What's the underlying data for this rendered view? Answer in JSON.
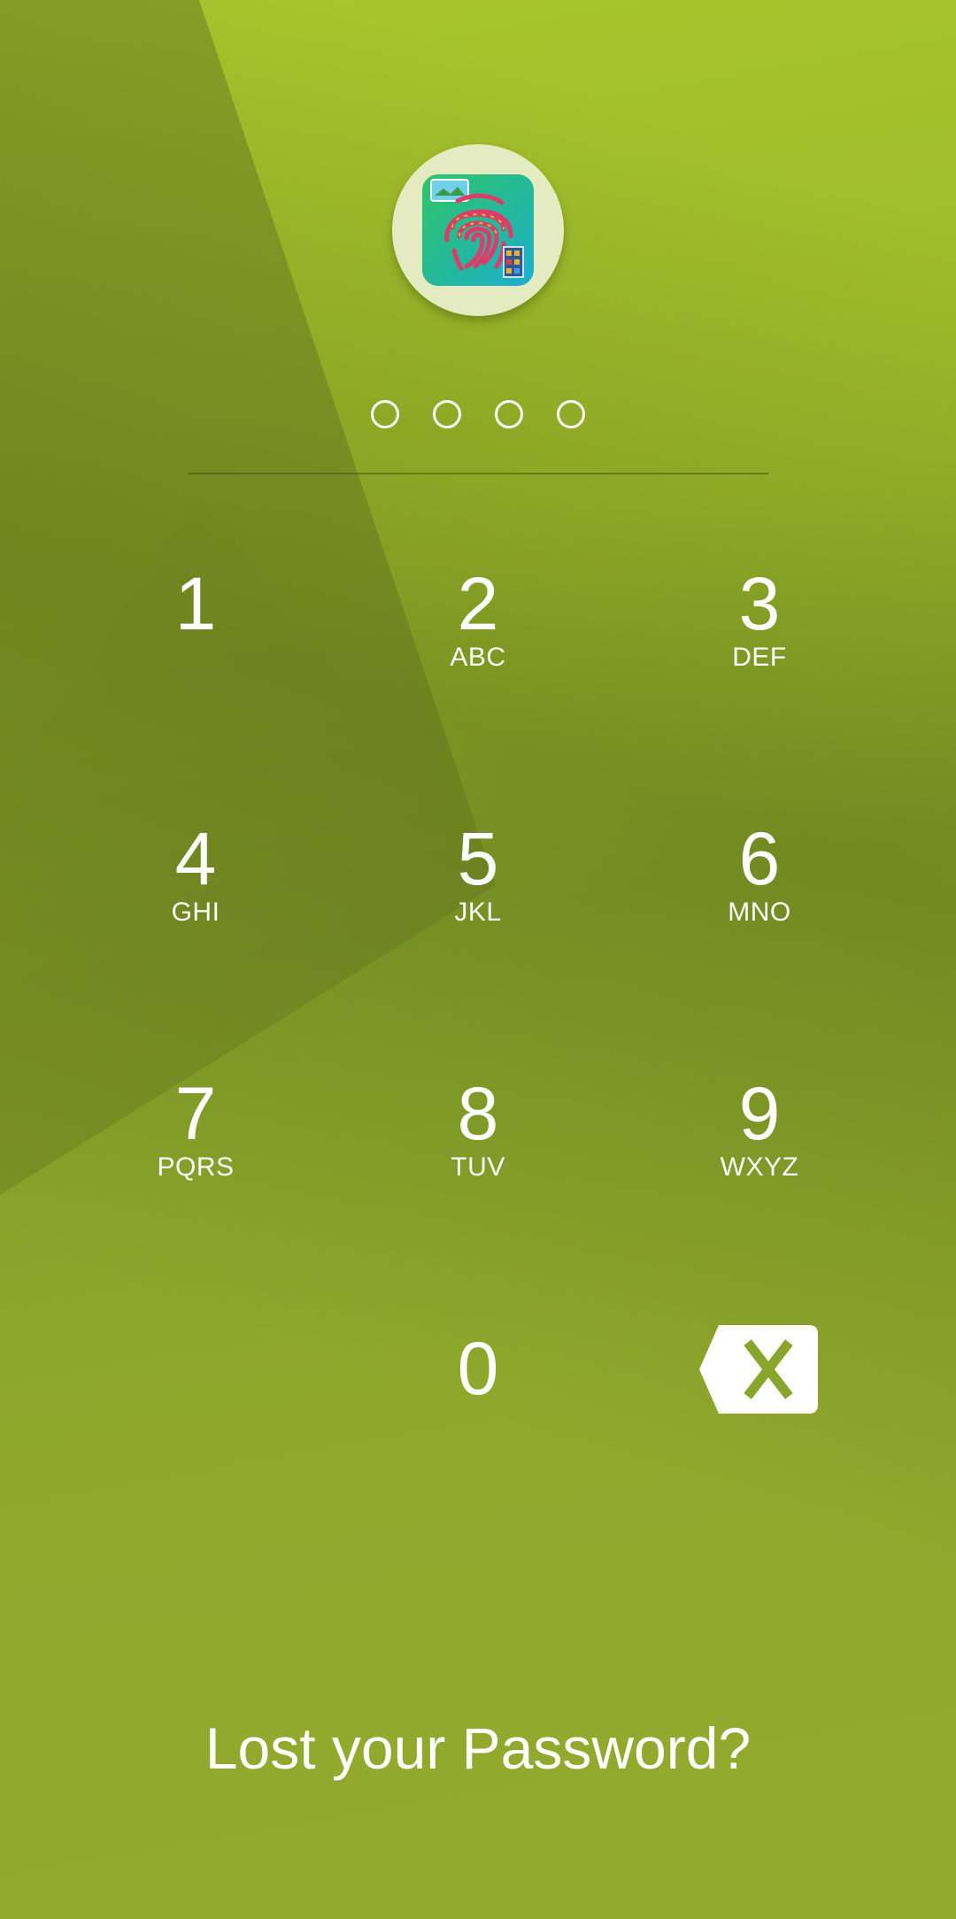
{
  "app": {
    "icon_name": "fingerprint-app-icon"
  },
  "pin": {
    "length": 4,
    "entered": 0
  },
  "keypad": {
    "keys": [
      {
        "digit": "1",
        "letters": ""
      },
      {
        "digit": "2",
        "letters": "ABC"
      },
      {
        "digit": "3",
        "letters": "DEF"
      },
      {
        "digit": "4",
        "letters": "GHI"
      },
      {
        "digit": "5",
        "letters": "JKL"
      },
      {
        "digit": "6",
        "letters": "MNO"
      },
      {
        "digit": "7",
        "letters": "PQRS"
      },
      {
        "digit": "8",
        "letters": "TUV"
      },
      {
        "digit": "9",
        "letters": "WXYZ"
      },
      {
        "digit": "0",
        "letters": ""
      }
    ],
    "backspace_icon": "backspace-icon"
  },
  "footer": {
    "lost_password_label": "Lost your Password?"
  },
  "colors": {
    "background": "#9bb82a",
    "accent": "#ffffff",
    "backspace_glyph": "#8aa52c"
  }
}
